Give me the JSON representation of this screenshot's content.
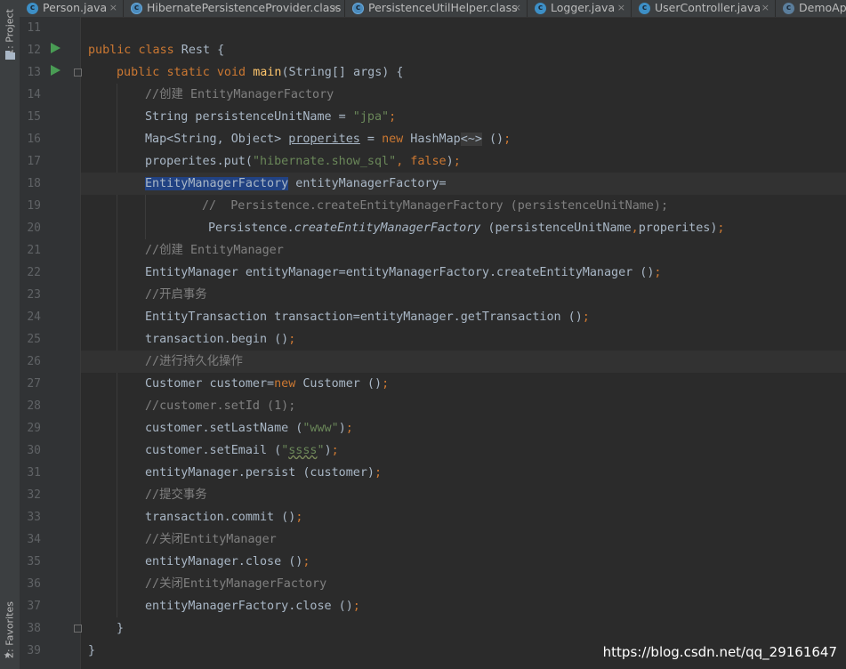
{
  "sidebar": {
    "project_label": "1: Project",
    "favorites_label": "2: Favorites",
    "project_icon": "folder-icon",
    "favorites_icon": "star-icon"
  },
  "tabs": [
    {
      "label": "Person.java",
      "icon": "class-icon"
    },
    {
      "label": "HibernatePersistenceProvider.class",
      "icon": "compiled-class-icon"
    },
    {
      "label": "PersistenceUtilHelper.class",
      "icon": "compiled-class-icon"
    },
    {
      "label": "Logger.java",
      "icon": "class-icon"
    },
    {
      "label": "UserController.java",
      "icon": "class-icon"
    },
    {
      "label": "DemoAp",
      "icon": "spring-boot-icon"
    }
  ],
  "gutter": {
    "line_numbers": [
      "11",
      "12",
      "13",
      "14",
      "15",
      "16",
      "17",
      "18",
      "19",
      "20",
      "21",
      "22",
      "23",
      "24",
      "25",
      "26",
      "27",
      "28",
      "29",
      "30",
      "31",
      "32",
      "33",
      "34",
      "35",
      "36",
      "37",
      "38",
      "39"
    ]
  },
  "code": {
    "l11": "",
    "l12_kw1": "public",
    "l12_kw2": "class",
    "l12_rest": " Rest {",
    "l13_kw1": "public",
    "l13_kw2": "static",
    "l13_kw3": "void",
    "l13_fn": "main",
    "l13_rest": "(String[] args) {",
    "l14": "//创建 EntityManagerFactory",
    "l15_a": "String persistenceUnitName = ",
    "l15_str": "\"jpa\"",
    "l15_semi": ";",
    "l16_a": "Map<String, Object> ",
    "l16_var": "properites",
    "l16_b": " = ",
    "l16_kw": "new",
    "l16_c": " HashMap",
    "l16_d": "<~>",
    "l16_e": " ()",
    "l16_semi": ";",
    "l17_a": "properites.put(",
    "l17_str": "\"hibernate.show_sql\"",
    "l17_comma": ",",
    "l17_kw": " false",
    "l17_b": ")",
    "l17_semi": ";",
    "l18_sel": "EntityManagerFactory",
    "l18_rest": " entityManagerFactory=",
    "l19": "//  Persistence.createEntityManagerFactory (persistenceUnitName);",
    "l20_a": "Persistence.",
    "l20_it": "createEntityManagerFactory",
    "l20_b": " (persistenceUnitName",
    "l20_comma": ",",
    "l20_c": "properites)",
    "l20_semi": ";",
    "l21": "//创建 EntityManager",
    "l22_a": "EntityManager entityManager=entityManagerFactory.createEntityManager ()",
    "l22_semi": ";",
    "l23": "//开启事务",
    "l24_a": "EntityTransaction transaction=entityManager.getTransaction ()",
    "l24_semi": ";",
    "l25_a": "transaction.begin ()",
    "l25_semi": ";",
    "l26": "//进行持久化操作",
    "l27_a": "Customer customer=",
    "l27_kw": "new",
    "l27_b": " Customer ()",
    "l27_semi": ";",
    "l28": "//customer.setId (1);",
    "l29_a": "customer.setLastName (",
    "l29_str": "\"www\"",
    "l29_b": ")",
    "l29_semi": ";",
    "l30_a": "customer.setEmail (",
    "l30_q1": "\"",
    "l30_str": "ssss",
    "l30_q2": "\"",
    "l30_b": ")",
    "l30_semi": ";",
    "l31_a": "entityManager.persist (customer)",
    "l31_semi": ";",
    "l32": "//提交事务",
    "l33_a": "transaction.commit ()",
    "l33_semi": ";",
    "l34": "//关闭EntityManager",
    "l35_a": "entityManager.close ()",
    "l35_semi": ";",
    "l36": "//关闭EntityManagerFactory",
    "l37_a": "entityManagerFactory.close ()",
    "l37_semi": ";",
    "l38": "}",
    "l39": "}"
  },
  "watermark": "https://blog.csdn.net/qq_29161647",
  "colors": {
    "background": "#2b2b2b",
    "keyword": "#cc7832",
    "string": "#6a8759",
    "comment": "#808080",
    "method_decl": "#ffc66d",
    "selection": "#214283",
    "run_icon": "#499c54"
  }
}
